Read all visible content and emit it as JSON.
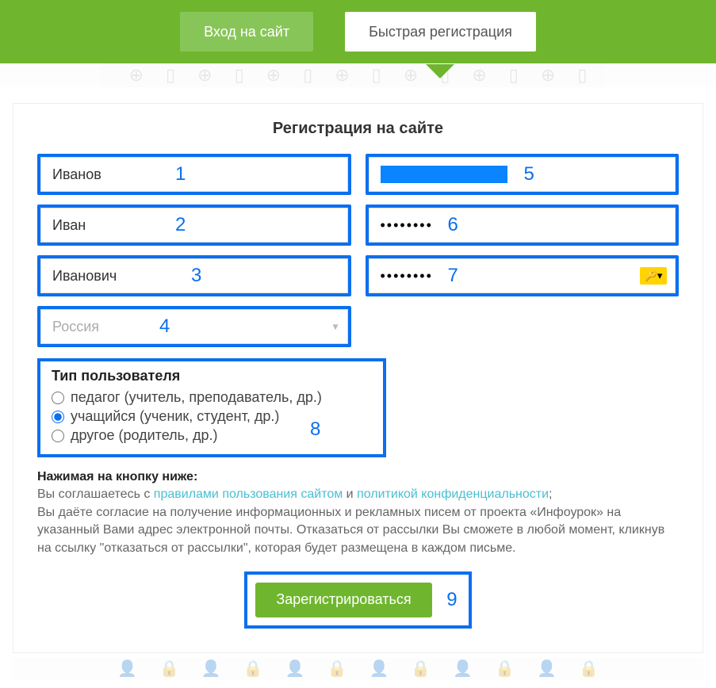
{
  "tabs": {
    "login": "Вход на сайт",
    "register": "Быстрая регистрация"
  },
  "form": {
    "title": "Регистрация на сайте",
    "surname": {
      "value": "Иванов",
      "annot": "1"
    },
    "name": {
      "value": "Иван",
      "annot": "2"
    },
    "patronymic": {
      "value": "Иванович",
      "annot": "3"
    },
    "country": {
      "value": "Россия",
      "annot": "4"
    },
    "email": {
      "value": "",
      "annot": "5"
    },
    "password": {
      "value": "••••••••",
      "annot": "6"
    },
    "password2": {
      "value": "••••••••",
      "annot": "7"
    }
  },
  "user_type": {
    "title": "Тип пользователя",
    "annot": "8",
    "options": [
      {
        "label": "педагог (учитель, преподаватель, др.)",
        "checked": false
      },
      {
        "label": "учащийся (ученик, студент, др.)",
        "checked": true
      },
      {
        "label": "другое (родитель, др.)",
        "checked": false
      }
    ]
  },
  "legal": {
    "lead": "Нажимая на кнопку ниже:",
    "p1a": "Вы соглашаетесь с ",
    "link1": "правилами пользования сайтом",
    "p1b": " и ",
    "link2": "политикой конфиденциальности",
    "p1c": ";",
    "p2": "Вы даёте согласие на получение информационных и рекламных писем от проекта «Инфоурок» на указанный Вами адрес электронной почты. Отказаться от рассылки Вы сможете в любой момент, кликнув на ссылку \"отказаться от рассылки\", которая будет размещена в каждом письме."
  },
  "submit": {
    "label": "Зарегистрироваться",
    "annot": "9"
  }
}
